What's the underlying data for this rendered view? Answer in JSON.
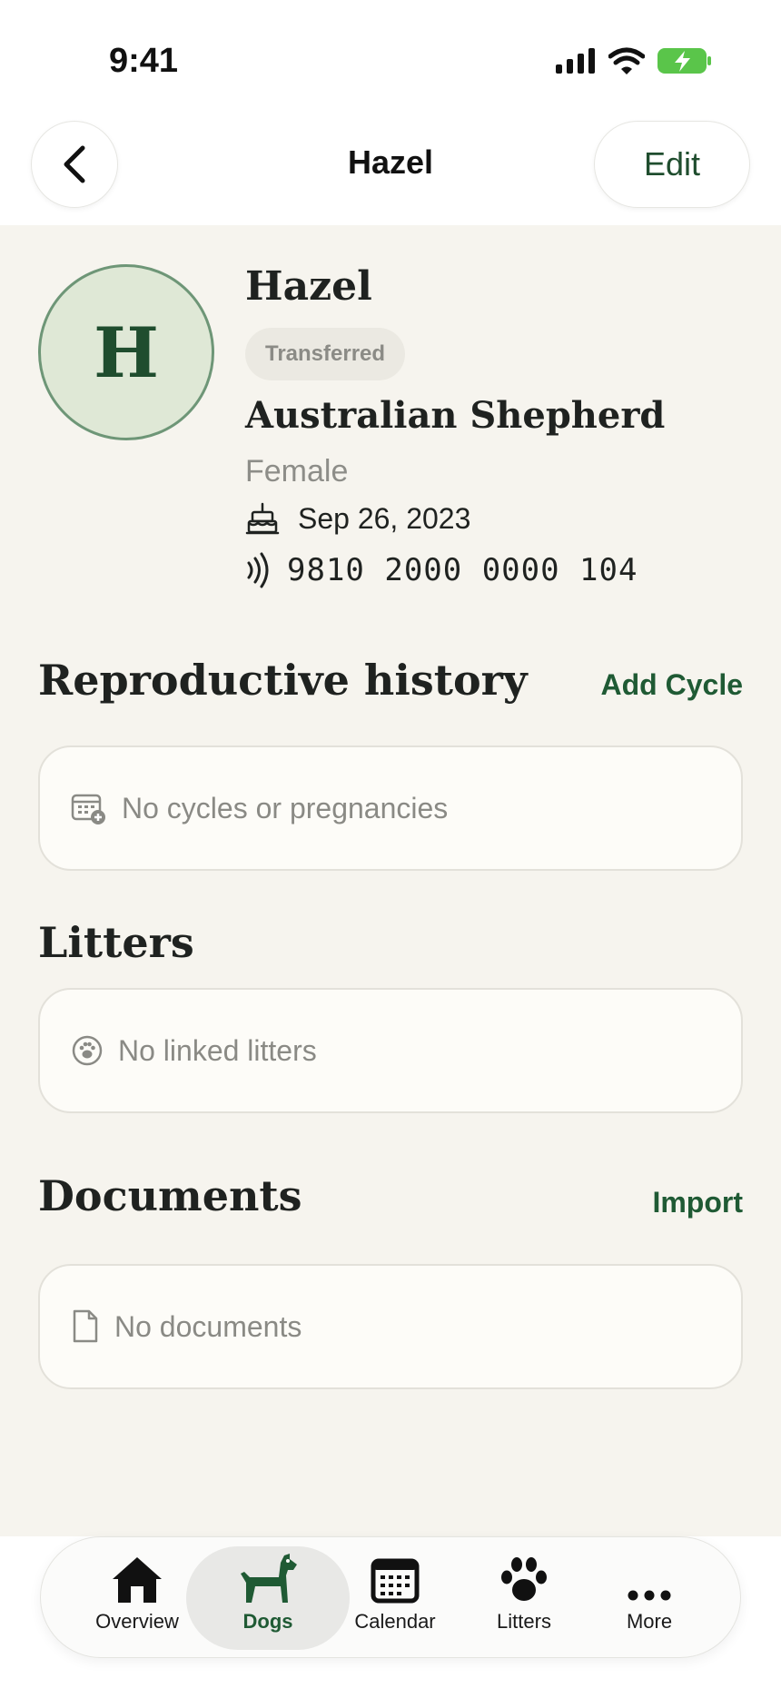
{
  "status_bar": {
    "time": "9:41"
  },
  "nav": {
    "title": "Hazel",
    "edit_label": "Edit"
  },
  "profile": {
    "avatar_initial": "H",
    "name": "Hazel",
    "status": "Transferred",
    "breed": "Australian Shepherd",
    "sex": "Female",
    "birthdate": "Sep 26, 2023",
    "microchip": "9810 2000 0000 104"
  },
  "sections": {
    "reproductive": {
      "title": "Reproductive history",
      "action": "Add Cycle",
      "empty": "No cycles or pregnancies"
    },
    "litters": {
      "title": "Litters",
      "empty": "No linked litters"
    },
    "documents": {
      "title": "Documents",
      "action": "Import",
      "empty": "No documents"
    }
  },
  "tabs": [
    {
      "label": "Overview",
      "icon": "house-icon"
    },
    {
      "label": "Dogs",
      "icon": "dog-icon",
      "active": true
    },
    {
      "label": "Calendar",
      "icon": "calendar-icon"
    },
    {
      "label": "Litters",
      "icon": "paw-icon"
    },
    {
      "label": "More",
      "icon": "ellipsis-icon"
    }
  ],
  "colors": {
    "accent": "#1f5a34",
    "background": "#f6f4ee",
    "avatar_fill": "#dfe8d6",
    "battery": "#5ac54a"
  }
}
